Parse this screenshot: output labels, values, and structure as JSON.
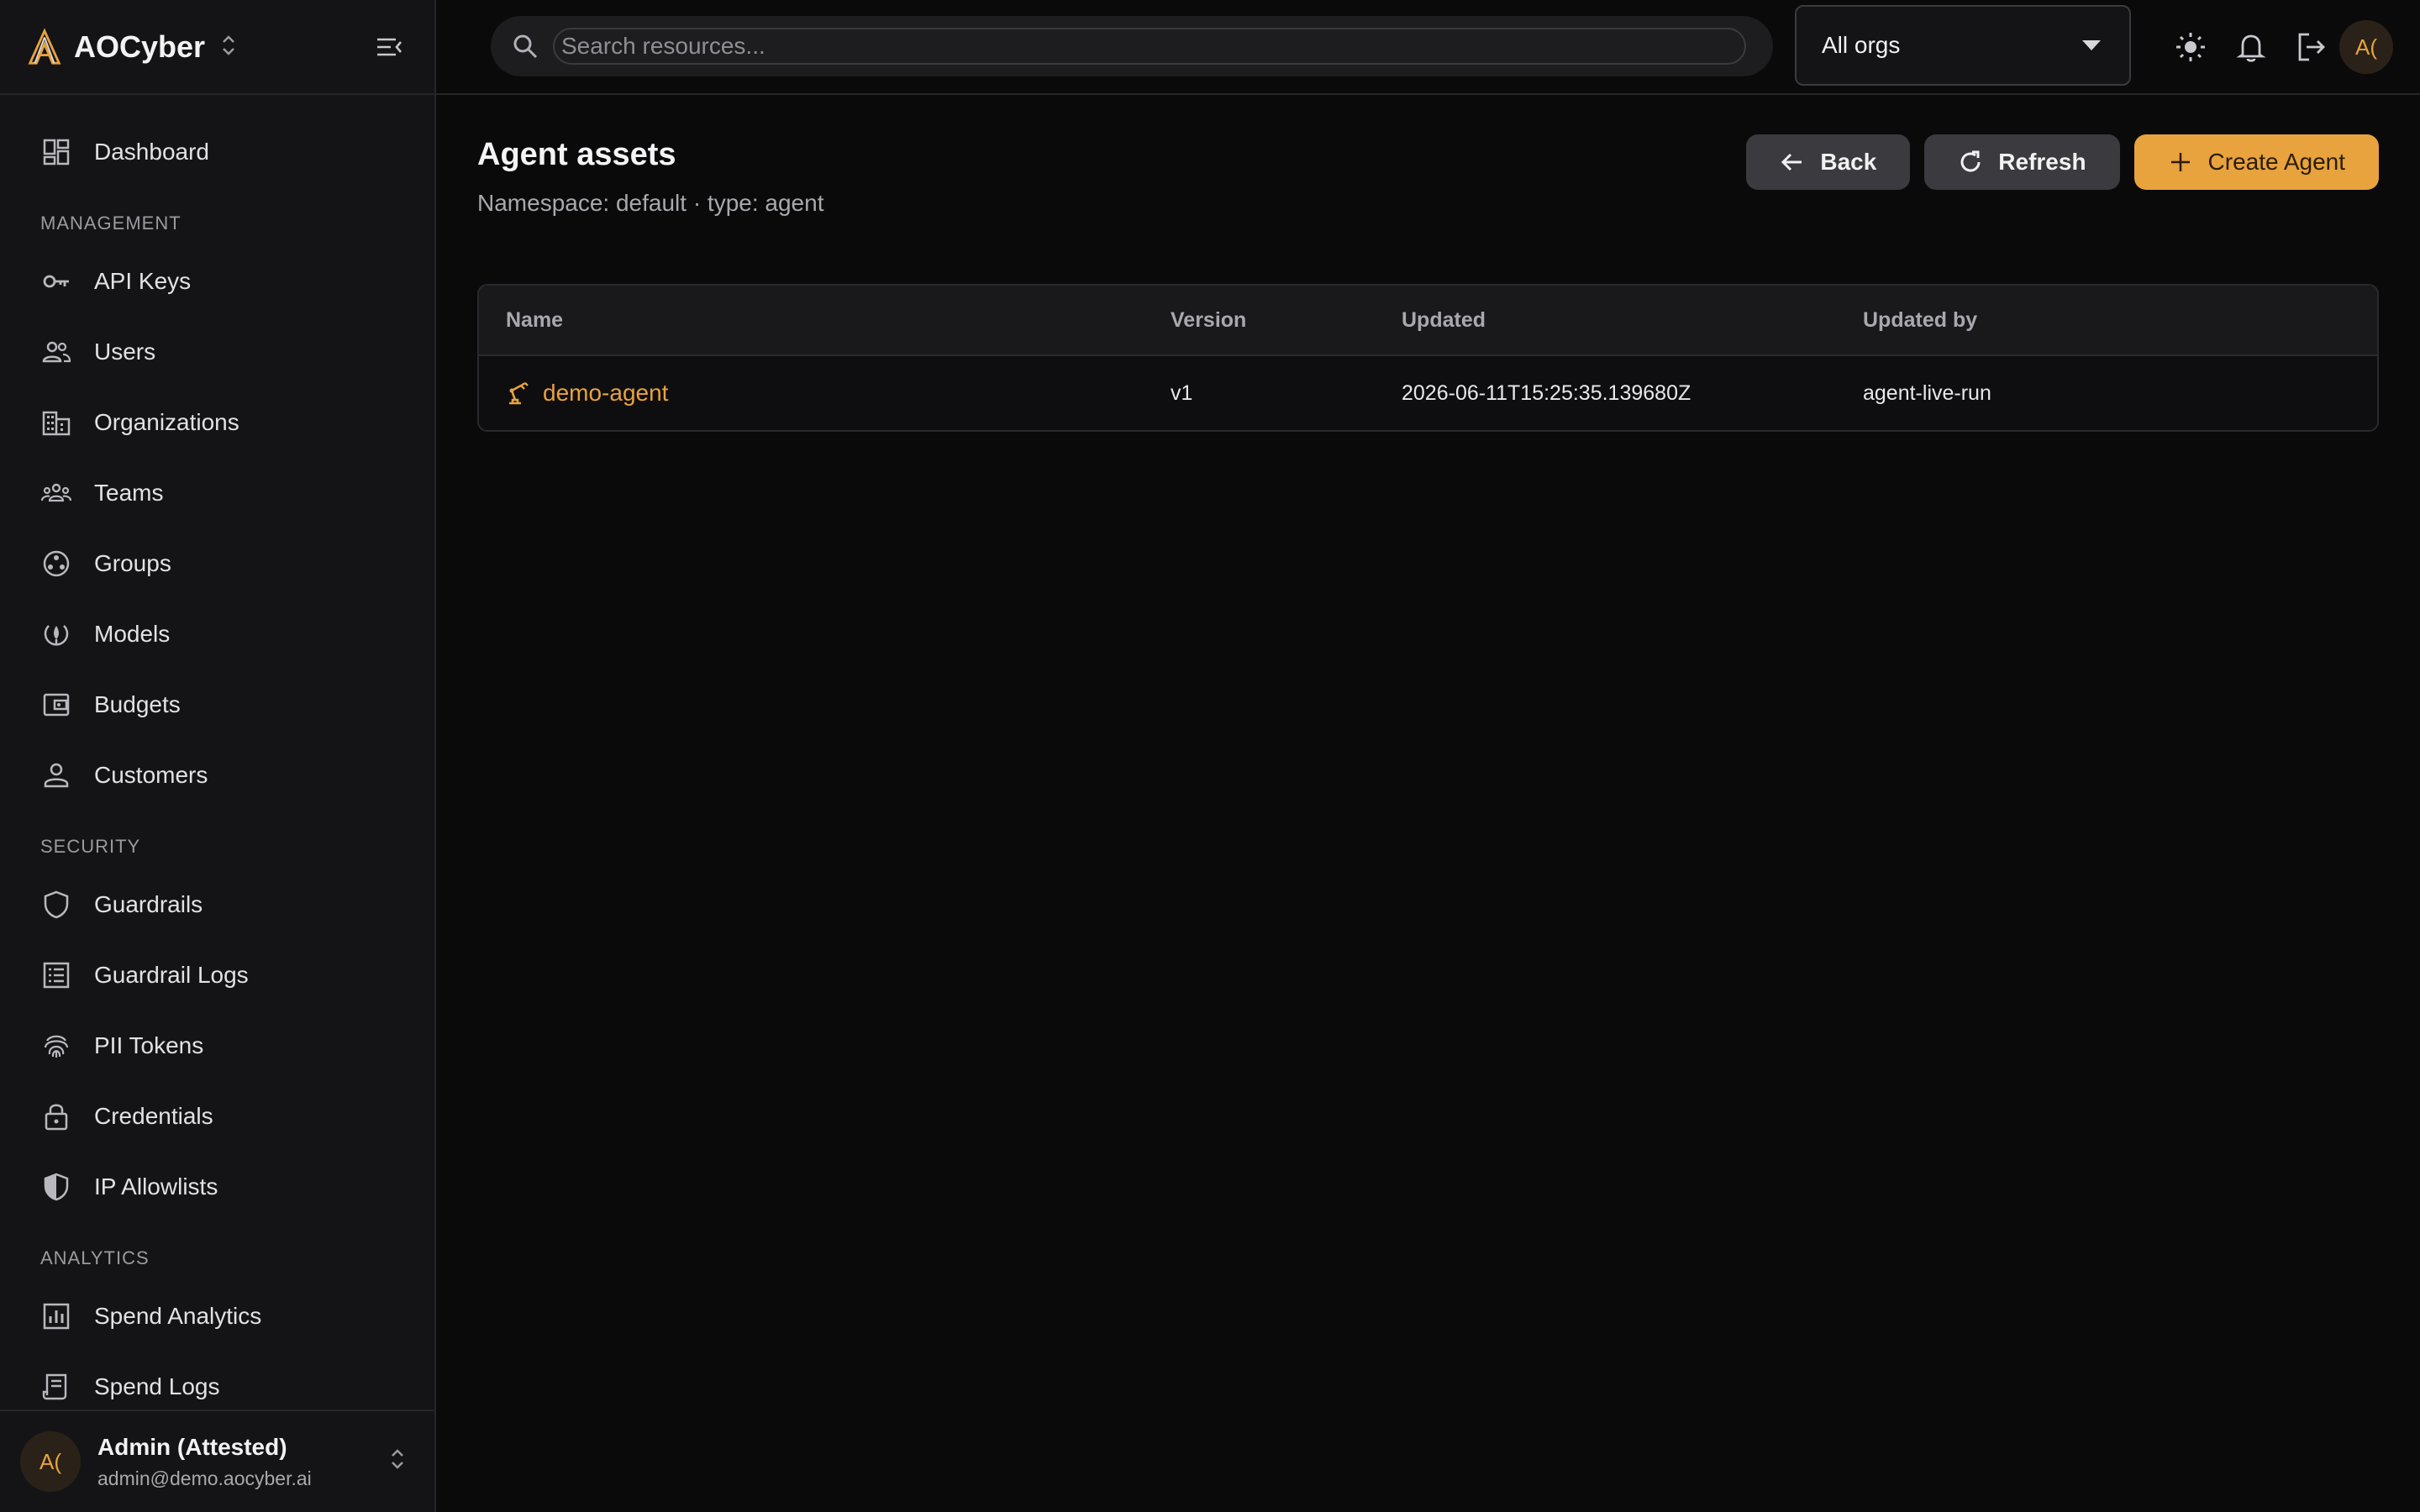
{
  "brand": {
    "name": "AOCyber"
  },
  "nav": {
    "top": [
      {
        "label": "Dashboard",
        "icon": "dashboard-icon"
      }
    ],
    "sections": [
      {
        "label": "MANAGEMENT",
        "items": [
          {
            "label": "API Keys",
            "icon": "key-icon"
          },
          {
            "label": "Users",
            "icon": "users-icon"
          },
          {
            "label": "Organizations",
            "icon": "building-icon"
          },
          {
            "label": "Teams",
            "icon": "teams-icon"
          },
          {
            "label": "Groups",
            "icon": "groups-icon"
          },
          {
            "label": "Models",
            "icon": "models-icon"
          },
          {
            "label": "Budgets",
            "icon": "wallet-icon"
          },
          {
            "label": "Customers",
            "icon": "person-icon"
          }
        ]
      },
      {
        "label": "SECURITY",
        "items": [
          {
            "label": "Guardrails",
            "icon": "shield-icon"
          },
          {
            "label": "Guardrail Logs",
            "icon": "list-icon"
          },
          {
            "label": "PII Tokens",
            "icon": "fingerprint-icon"
          },
          {
            "label": "Credentials",
            "icon": "lock-icon"
          },
          {
            "label": "IP Allowlists",
            "icon": "shield-half-icon"
          }
        ]
      },
      {
        "label": "ANALYTICS",
        "items": [
          {
            "label": "Spend Analytics",
            "icon": "chart-icon"
          },
          {
            "label": "Spend Logs",
            "icon": "receipt-icon"
          }
        ]
      }
    ]
  },
  "user": {
    "initials": "A(",
    "name": "Admin (Attested)",
    "email": "admin@demo.aocyber.ai"
  },
  "topbar": {
    "search_placeholder": "Search resources...",
    "org_select": "All orgs",
    "avatar_initials": "A("
  },
  "page": {
    "title": "Agent assets",
    "subtitle": "Namespace: default · type: agent"
  },
  "actions": {
    "back": "Back",
    "refresh": "Refresh",
    "create": "Create Agent"
  },
  "table": {
    "headers": [
      "Name",
      "Version",
      "Updated",
      "Updated by"
    ],
    "rows": [
      {
        "name": "demo-agent",
        "version": "v1",
        "updated": "2026-06-11T15:25:35.139680Z",
        "updated_by": "agent-live-run"
      }
    ]
  },
  "colors": {
    "accent": "#e8a23e",
    "background": "#0a0a0a",
    "sidebar": "#141416"
  }
}
